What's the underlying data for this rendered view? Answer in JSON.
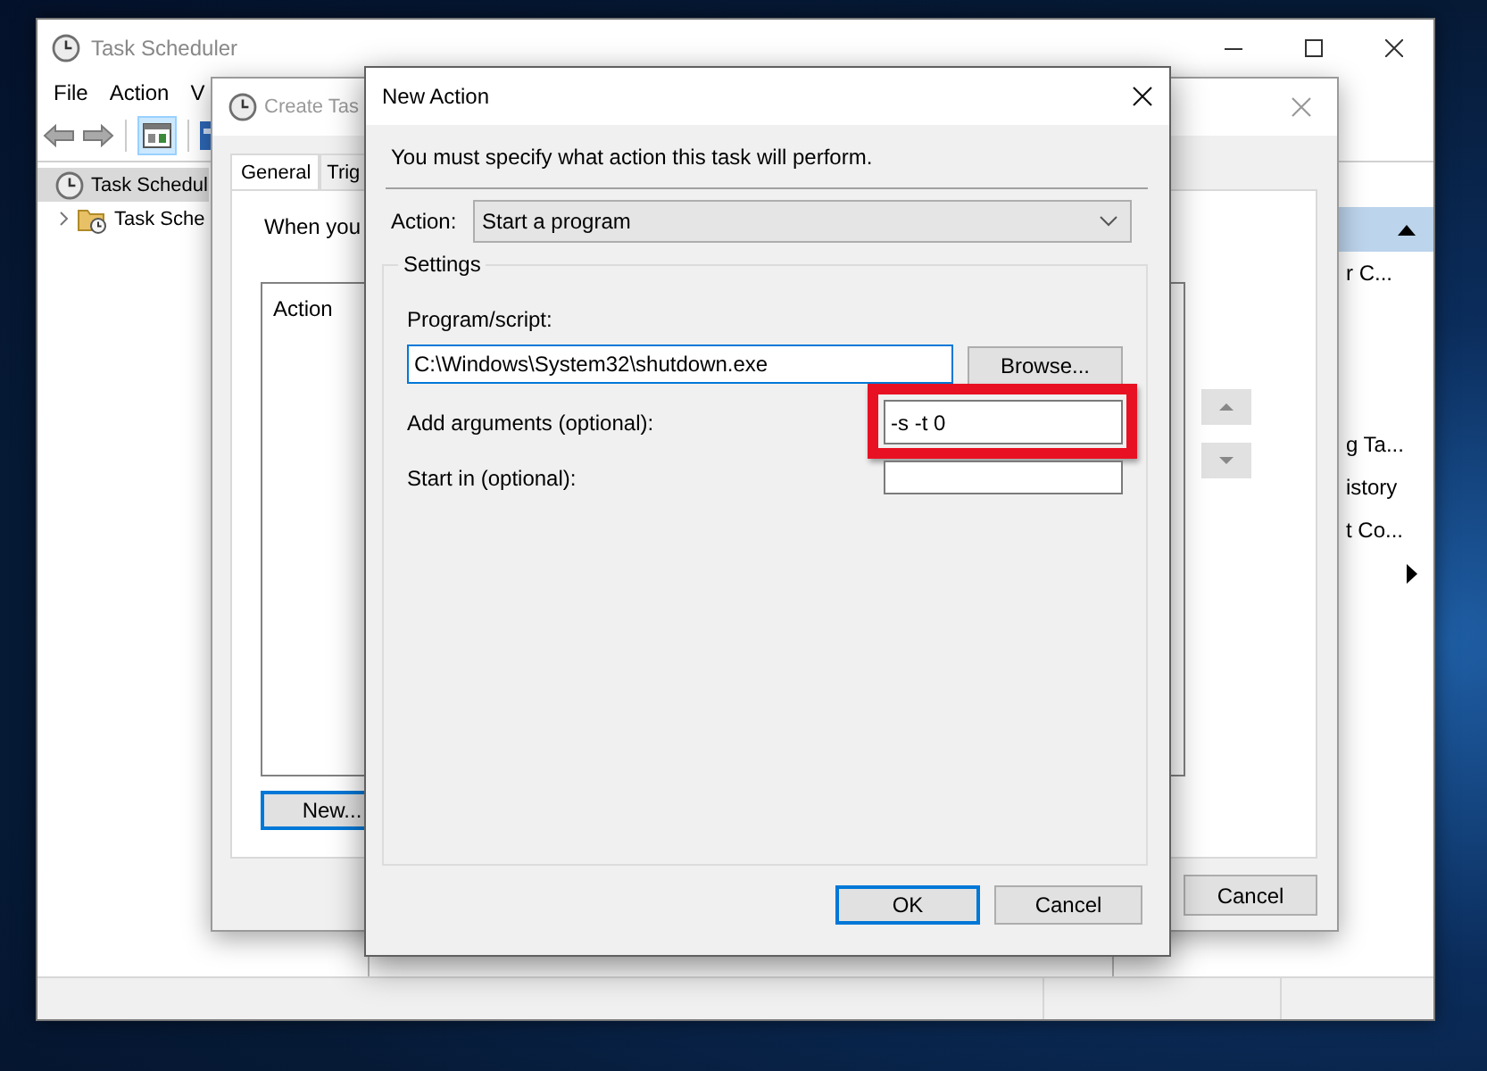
{
  "main_window": {
    "title": "Task Scheduler",
    "menu": [
      "File",
      "Action",
      "V"
    ],
    "tree": [
      {
        "label": "Task Schedul",
        "selected": true,
        "children": [
          {
            "label": "Task Sche",
            "selected": false,
            "expanded": false
          }
        ]
      }
    ],
    "actions_panel": [
      {
        "kind": "text",
        "label": "r C..."
      },
      {
        "kind": "text",
        "label": "g Ta..."
      },
      {
        "kind": "text",
        "label": "istory"
      },
      {
        "kind": "text",
        "label": "t Co..."
      },
      {
        "kind": "submenu"
      }
    ]
  },
  "create_task": {
    "title": "Create Tas",
    "tabs": [
      {
        "label": "General",
        "selected": true
      },
      {
        "label": "Trig",
        "selected": false
      }
    ],
    "intro": "When you",
    "list_header": "Action",
    "new_button": {
      "label": "New...",
      "focused": true
    },
    "cancel_button": "Cancel"
  },
  "new_action": {
    "title": "New Action",
    "instruction": "You must specify what action this task will perform.",
    "action_label": "Action:",
    "action_value": "Start a program",
    "group_label": "Settings",
    "fields": [
      {
        "kind": "stacked",
        "label": "Program/script:",
        "value": "C:\\Windows\\System32\\shutdown.exe",
        "focused": true,
        "highlighted": false,
        "button": "Browse..."
      },
      {
        "kind": "inline",
        "label": "Add arguments (optional):",
        "value": "-s -t 0",
        "focused": false,
        "highlighted": true
      },
      {
        "kind": "inline",
        "label": "Start in (optional):",
        "focused": false,
        "highlighted": false
      }
    ],
    "buttons": [
      {
        "label": "OK",
        "default": true
      },
      {
        "label": "Cancel",
        "default": false
      }
    ]
  }
}
